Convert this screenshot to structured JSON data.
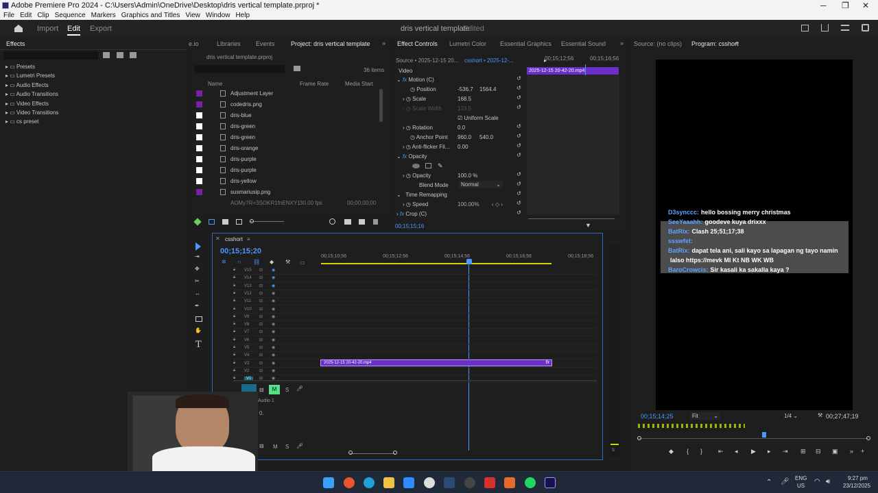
{
  "window": {
    "title": "Adobe Premiere Pro 2024 - C:\\Users\\Admin\\OneDrive\\Desktop\\dris vertical template.prproj *",
    "min": "─",
    "max": "❐",
    "close": "✕"
  },
  "menu": [
    "File",
    "Edit",
    "Clip",
    "Sequence",
    "Markers",
    "Graphics and Titles",
    "View",
    "Window",
    "Help"
  ],
  "topnav": {
    "import": "Import",
    "edit": "Edit",
    "export": "Export",
    "project": "dris vertical template",
    "status": "- Edited"
  },
  "effects": {
    "tab": "Effects",
    "items": [
      "Presets",
      "Lumetri Presets",
      "Audio Effects",
      "Audio Transitions",
      "Video Effects",
      "Video Transitions",
      "cs preset"
    ]
  },
  "project": {
    "tabs": [
      "e.io",
      "Libraries",
      "Events",
      "Project: dris vertical template"
    ],
    "file": "dris vertical template.prproj",
    "count": "36 items",
    "headers": [
      "Name",
      "Frame Rate",
      "Media Start"
    ],
    "items": [
      {
        "name": "Adjustment Layer",
        "color": "#7a1fa2"
      },
      {
        "name": "codedris.png",
        "color": "#7a1fa2"
      },
      {
        "name": "dris-blue",
        "color": "#ffffff"
      },
      {
        "name": "dris-green",
        "color": "#ffffff"
      },
      {
        "name": "dris-green",
        "color": "#ffffff"
      },
      {
        "name": "dris-orange",
        "color": "#ffffff"
      },
      {
        "name": "dris-purple",
        "color": "#ffffff"
      },
      {
        "name": "dris-purple",
        "color": "#ffffff"
      },
      {
        "name": "dris-yellow",
        "color": "#ffffff"
      },
      {
        "name": "susmariusip.png",
        "color": "#7a1fa2"
      }
    ],
    "lastrow": {
      "name": "AOMy7R=3SOKR1fnENXY1",
      "fps": "30.00 fps",
      "start": "00;00;00;00"
    }
  },
  "effectControls": {
    "tabs": [
      "Effect Controls",
      "Lumetri Color",
      "Essential Graphics",
      "Essential Sound"
    ],
    "source": "Source • 2025-12-15 20...",
    "seq": "csshort • 2025-12-...",
    "section": "Video",
    "time1": "00;15;12;56",
    "time2": "00;15;16;56",
    "clip": "2025-12-15 20-42-20.mp4",
    "rows": [
      {
        "label": "Motion (C)",
        "v1": "",
        "v2": ""
      },
      {
        "label": "Position",
        "v1": "-536.7",
        "v2": "1564.4"
      },
      {
        "label": "Scale",
        "v1": "168.5",
        "v2": ""
      },
      {
        "label": "Scale Width",
        "v1": "123.5",
        "v2": ""
      },
      {
        "label": "Uniform Scale",
        "v1": "",
        "v2": ""
      },
      {
        "label": "Rotation",
        "v1": "0.0",
        "v2": ""
      },
      {
        "label": "Anchor Point",
        "v1": "960.0",
        "v2": "540.0"
      },
      {
        "label": "Anti-flicker Fil...",
        "v1": "0.00",
        "v2": ""
      },
      {
        "label": "Opacity",
        "v1": "",
        "v2": ""
      },
      {
        "label": "Opacity",
        "v1": "100.0 %",
        "v2": ""
      },
      {
        "label": "Blend Mode",
        "v1": "Normal",
        "v2": ""
      },
      {
        "label": "Time Remapping",
        "v1": "",
        "v2": ""
      },
      {
        "label": "Speed",
        "v1": "100.00%",
        "v2": ""
      },
      {
        "label": "Crop (C)",
        "v1": "",
        "v2": ""
      }
    ],
    "bottomtime": "00;15;15;16"
  },
  "timeline": {
    "tab": "csshort",
    "time": "00;15;15;20",
    "ruler": [
      "00;15;10;56",
      "00;15;12;56",
      "00;15;14;56",
      "00;15;16;56",
      "00;15;18;56"
    ],
    "tracks": [
      "V15",
      "V14",
      "V13",
      "V12",
      "V11",
      "V10",
      "V9",
      "V8",
      "V7",
      "V6",
      "V5",
      "V4",
      "V3",
      "V2",
      "V1"
    ],
    "clip": "2025-12-15 20-42-20.mp4",
    "audio": "Audio 1",
    "a1": "A1",
    "m": "M",
    "s": "S",
    "vol": "0."
  },
  "monitors": {
    "source": "Source: (no clips)",
    "program": "Program: csshort",
    "timecode": "00;15;14;25",
    "fit": "Fit",
    "res": "1/4",
    "duration": "00;27;47;19"
  },
  "chat": [
    {
      "user": "D3synccc:",
      "msg": "hello bossing merry christmas"
    },
    {
      "user": "SeeYaaahh:",
      "msg": "goodeve kuya drixxx"
    },
    {
      "user": "BatRix:",
      "msg": "Clash 25;51;17;38"
    },
    {
      "user": "ssswfet:",
      "msg": ""
    },
    {
      "user": "BatRix:",
      "msg": "dapat tela ani, sali kayo sa lapagan ng tayo namin"
    },
    {
      "user": "",
      "msg": "lalso https://mevk Ml Kt NB WK WB"
    },
    {
      "user": "BaroCrowcis:",
      "msg": "Sir kasali ka sakalla kaya ?"
    }
  ],
  "taskbar": {
    "lang1": "ENG",
    "lang2": "US",
    "time": "9:27 pm",
    "date": "23/12/2025"
  }
}
